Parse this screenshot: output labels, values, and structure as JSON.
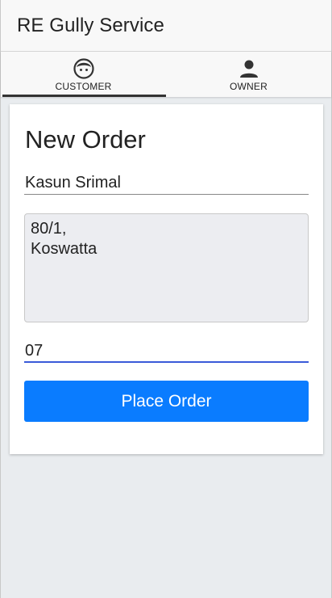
{
  "app": {
    "title": "RE Gully Service"
  },
  "tabs": [
    {
      "label": "CUSTOMER",
      "icon": "face-icon",
      "active": true
    },
    {
      "label": "OWNER",
      "icon": "person-icon",
      "active": false
    }
  ],
  "form": {
    "title": "New Order",
    "name_value": "Kasun Srimal",
    "address_value": "80/1,\nKoswatta",
    "phone_value": "07",
    "submit_label": "Place Order"
  },
  "colors": {
    "accent": "#0a7cff",
    "focus_underline": "#3a5bd9",
    "background": "#e9ecef"
  }
}
